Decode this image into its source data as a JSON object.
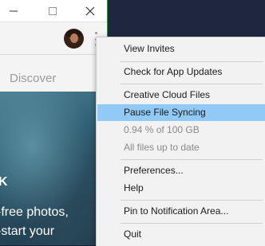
{
  "background_app": {
    "window_controls": {
      "minimize": "–",
      "maximize": "☐",
      "close": "✕"
    },
    "nav": {
      "discover_label": "Discover"
    },
    "hero": {
      "mark": "K",
      "line1": "-free photos,",
      "line2": "-start your"
    }
  },
  "context_menu": {
    "items": [
      {
        "label": "View Invites",
        "enabled": true
      },
      {
        "label": "Check for App Updates",
        "enabled": true
      },
      {
        "label": "Creative Cloud Files",
        "enabled": true
      },
      {
        "label": "Pause File Syncing",
        "enabled": true,
        "highlighted": true
      },
      {
        "label": "0.94 % of 100 GB",
        "enabled": false
      },
      {
        "label": "All files up to date",
        "enabled": false
      },
      {
        "label": "Preferences...",
        "enabled": true
      },
      {
        "label": "Help",
        "enabled": true
      },
      {
        "label": "Pin to Notification Area...",
        "enabled": true
      },
      {
        "label": "Quit",
        "enabled": true
      }
    ]
  },
  "colors": {
    "menu_background": "#f2f2f2",
    "menu_highlight": "#91c9f7",
    "disabled_text": "#8a8a8a",
    "desktop_background": "#1e2640"
  }
}
